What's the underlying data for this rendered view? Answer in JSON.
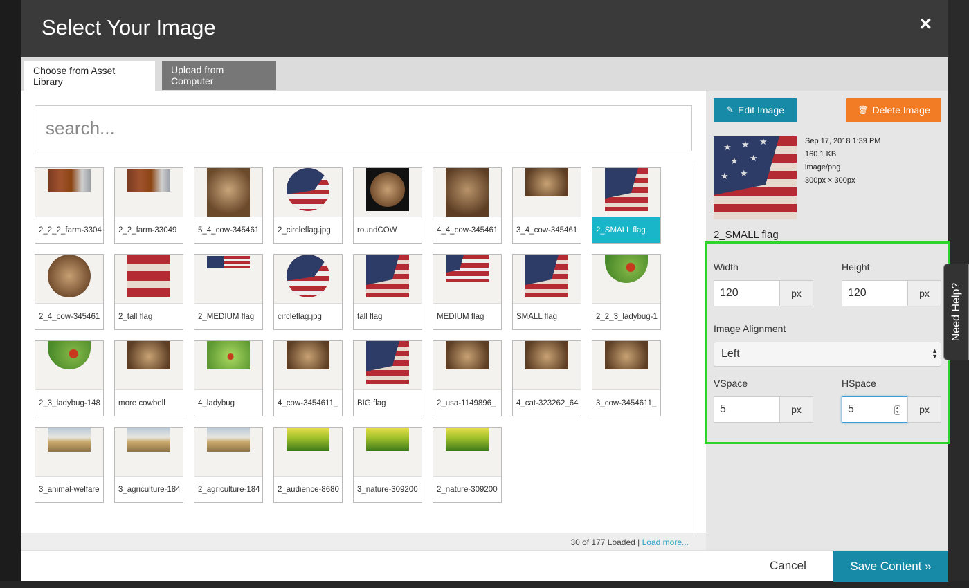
{
  "modal": {
    "title": "Select Your Image",
    "close_label": "×"
  },
  "tabs": [
    {
      "label": "Choose from Asset Library"
    },
    {
      "label": "Upload from Computer"
    }
  ],
  "search": {
    "placeholder": "search..."
  },
  "assets": [
    {
      "caption": "2_2_2_farm-3304",
      "thumb": "horses"
    },
    {
      "caption": "2_2_farm-33049",
      "thumb": "horses"
    },
    {
      "caption": "5_4_cow-345461",
      "thumb": "cow-sepia"
    },
    {
      "caption": "2_circleflag.jpg",
      "thumb": "flag-circle"
    },
    {
      "caption": "roundCOW",
      "thumb": "cow-circle-dark"
    },
    {
      "caption": "4_4_cow-345461",
      "thumb": "cow-tall"
    },
    {
      "caption": "3_4_cow-345461",
      "thumb": "cow-small"
    },
    {
      "caption": "2_SMALL flag",
      "thumb": "flag-square",
      "selected": true
    },
    {
      "caption": "2_4_cow-345461",
      "thumb": "cow-circle"
    },
    {
      "caption": "2_tall flag",
      "thumb": "flag-tall"
    },
    {
      "caption": "2_MEDIUM flag",
      "thumb": "flag-strip"
    },
    {
      "caption": "circleflag.jpg",
      "thumb": "flag-circle"
    },
    {
      "caption": "tall flag",
      "thumb": "flag-square"
    },
    {
      "caption": "MEDIUM flag",
      "thumb": "flag-medium"
    },
    {
      "caption": "SMALL flag",
      "thumb": "flag-square"
    },
    {
      "caption": "2_2_3_ladybug-1",
      "thumb": "ladybug-half"
    },
    {
      "caption": "2_3_ladybug-148",
      "thumb": "ladybug-half"
    },
    {
      "caption": "more cowbell",
      "thumb": "cow-small"
    },
    {
      "caption": "4_ladybug",
      "thumb": "ladybug-rect"
    },
    {
      "caption": "4_cow-3454611_",
      "thumb": "cow-small"
    },
    {
      "caption": "BIG flag",
      "thumb": "flag-square"
    },
    {
      "caption": "2_usa-1149896_",
      "thumb": "cow-small"
    },
    {
      "caption": "4_cat-323262_64",
      "thumb": "cow-small"
    },
    {
      "caption": "3_cow-3454611_",
      "thumb": "cow-small"
    },
    {
      "caption": "3_animal-welfare",
      "thumb": "field"
    },
    {
      "caption": "3_agriculture-184",
      "thumb": "field"
    },
    {
      "caption": "2_agriculture-184",
      "thumb": "field"
    },
    {
      "caption": "2_audience-8680",
      "thumb": "meadow"
    },
    {
      "caption": "3_nature-309200",
      "thumb": "meadow"
    },
    {
      "caption": "2_nature-309200",
      "thumb": "meadow"
    }
  ],
  "loaded": {
    "count_text": "30 of 177 Loaded",
    "separator": "|",
    "load_more": "Load more..."
  },
  "details": {
    "edit_label": "Edit Image",
    "delete_label": "Delete Image",
    "date": "Sep 17, 2018 1:39 PM",
    "size": "160.1 KB",
    "type": "image/png",
    "dimensions": "300px × 300px",
    "name": "2_SMALL flag",
    "width_label": "Width",
    "width_value": "120",
    "height_label": "Height",
    "height_value": "120",
    "unit": "px",
    "alignment_label": "Image Alignment",
    "alignment_value": "Left",
    "vspace_label": "VSpace",
    "vspace_value": "5",
    "hspace_label": "HSpace",
    "hspace_value": "5"
  },
  "footer": {
    "cancel_label": "Cancel",
    "save_label": "Save Content »"
  },
  "help": {
    "label": "Need Help?"
  },
  "colors": {
    "accent": "#168aa6",
    "delete": "#f27c25",
    "selected": "#19b5c8",
    "highlight": "#2ed32e"
  }
}
